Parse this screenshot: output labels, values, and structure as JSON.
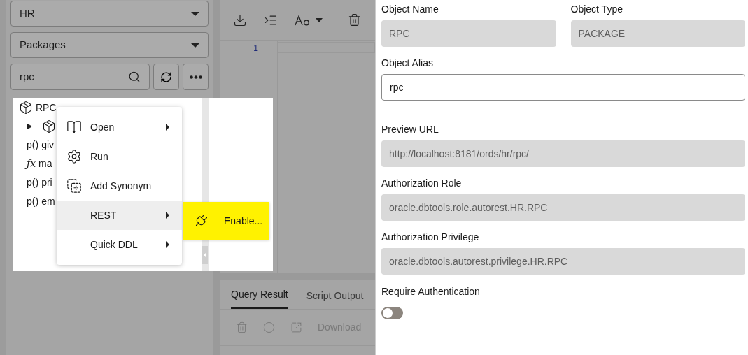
{
  "schema_select": {
    "value": "HR"
  },
  "type_select": {
    "value": "Packages"
  },
  "search": {
    "value": "rpc"
  },
  "tree": [
    {
      "label": "RPC",
      "kind": "package",
      "children": [
        {
          "kind": "package",
          "expanded": false
        },
        {
          "kind": "procedure",
          "glyph": "p()",
          "label": "giv"
        },
        {
          "kind": "function",
          "glyph": "ƒx",
          "label": "ma"
        },
        {
          "kind": "procedure",
          "glyph": "p()",
          "label": "pri"
        },
        {
          "kind": "procedure",
          "glyph": "p()",
          "label": "em"
        }
      ]
    }
  ],
  "context_menu": [
    {
      "label": "Open",
      "submenu": true,
      "selected": false
    },
    {
      "label": "Run",
      "submenu": false,
      "selected": false
    },
    {
      "label": "Add Synonym",
      "submenu": false,
      "selected": false
    },
    {
      "label": "REST",
      "submenu": true,
      "selected": true
    },
    {
      "label": "Quick DDL",
      "submenu": true,
      "selected": false
    }
  ],
  "submenu": [
    {
      "label": "Enable...",
      "selected": true
    }
  ],
  "editor": {
    "line_numbers": [
      "1"
    ]
  },
  "results": {
    "tabs": [
      {
        "label": "Query Result",
        "selected": true
      },
      {
        "label": "Script Output",
        "selected": false
      }
    ],
    "download_label": "Download"
  },
  "form": {
    "rows": [
      [
        {
          "label": "Object Name",
          "value": "RPC",
          "kind": "readonly"
        },
        {
          "label": "Object Type",
          "value": "PACKAGE",
          "kind": "readonly"
        }
      ],
      [
        {
          "label": "Object Alias",
          "value": "rpc",
          "kind": "input"
        }
      ],
      [
        {
          "label": "Preview URL",
          "value": "http://localhost:8181/ords/hr/rpc/",
          "kind": "readonly"
        }
      ],
      [
        {
          "label": "Authorization Role",
          "value": "oracle.dbtools.role.autorest.HR.RPC",
          "kind": "readonly"
        }
      ],
      [
        {
          "label": "Authorization Privilege",
          "value": "oracle.dbtools.autorest.privilege.HR.RPC",
          "kind": "readonly"
        }
      ]
    ],
    "toggle": {
      "label": "Require Authentication",
      "on": false
    }
  }
}
